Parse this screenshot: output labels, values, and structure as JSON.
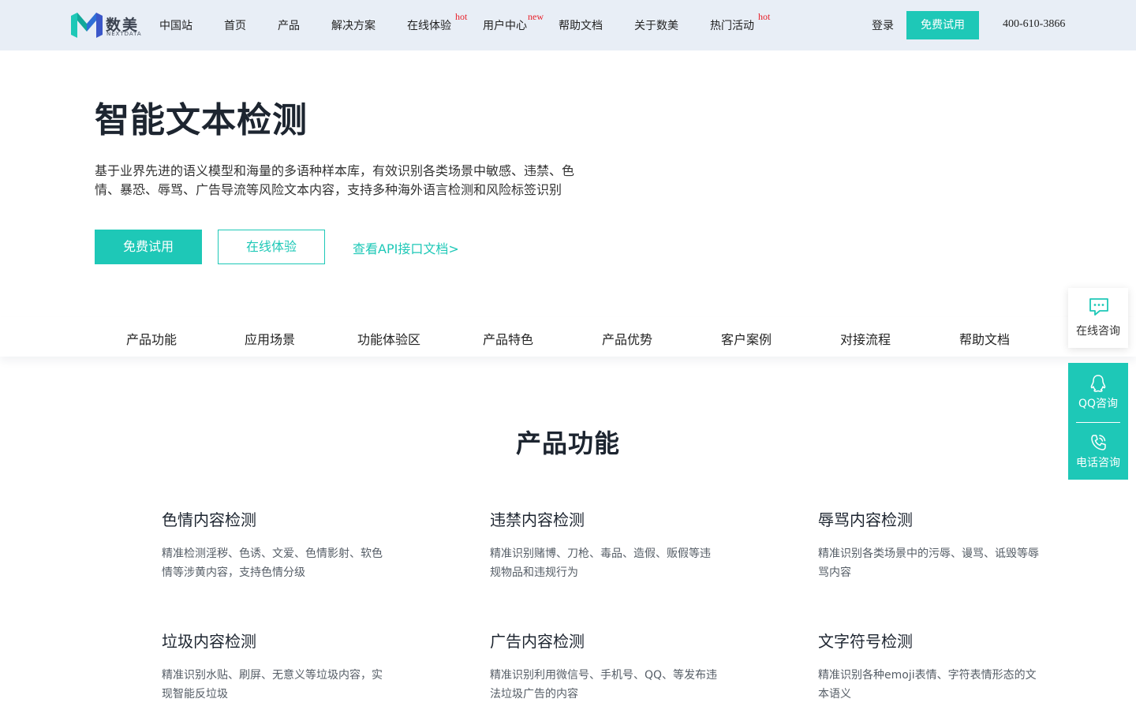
{
  "header": {
    "logo": {
      "cn": "数美",
      "en": "NEXTDATA"
    },
    "nav": [
      {
        "label": "中国站",
        "tag": ""
      },
      {
        "label": "首页",
        "tag": ""
      },
      {
        "label": "产品",
        "tag": ""
      },
      {
        "label": "解决方案",
        "tag": ""
      },
      {
        "label": "在线体验",
        "tag": "hot"
      },
      {
        "label": "用户中心",
        "tag": "new"
      },
      {
        "label": "帮助文档",
        "tag": ""
      },
      {
        "label": "关于数美",
        "tag": ""
      },
      {
        "label": "热门活动",
        "tag": "hot"
      }
    ],
    "login": "登录",
    "trial": "免费试用",
    "phone": "400-610-3866"
  },
  "hero": {
    "title": "智能文本检测",
    "description": "基于业界先进的语义模型和海量的多语种样本库，有效识别各类场景中敏感、违禁、色情、暴恐、辱骂、广告导流等风险文本内容，支持多种海外语言检测和风险标签识别",
    "primary_button": "免费试用",
    "secondary_button": "在线体验",
    "api_link": "查看API接口文档>"
  },
  "subnav": [
    "产品功能",
    "应用场景",
    "功能体验区",
    "产品特色",
    "产品优势",
    "客户案例",
    "对接流程",
    "帮助文档"
  ],
  "section": {
    "title": "产品功能",
    "features": [
      {
        "title": "色情内容检测",
        "desc": "精准检测淫秽、色诱、文爱、色情影射、软色情等涉黄内容，支持色情分级"
      },
      {
        "title": "违禁内容检测",
        "desc": "精准识别赌博、刀枪、毒品、造假、贩假等违规物品和违规行为"
      },
      {
        "title": "辱骂内容检测",
        "desc": "精准识别各类场景中的污辱、谩骂、诋毁等辱骂内容"
      },
      {
        "title": "垃圾内容检测",
        "desc": "精准识别水贴、刷屏、无意义等垃圾内容，实现智能反垃圾"
      },
      {
        "title": "广告内容检测",
        "desc": "精准识别利用微信号、手机号、QQ、等发布违法垃圾广告的内容"
      },
      {
        "title": "文字符号检测",
        "desc": "精准识别各种emoji表情、字符表情形态的文本语义"
      }
    ]
  },
  "side": {
    "online": "在线咨询",
    "qq": "QQ咨询",
    "tel": "电话咨询"
  },
  "colors": {
    "accent": "#1ec8b7",
    "header_bg": "#e8eef6",
    "tag": "#e8202a"
  }
}
